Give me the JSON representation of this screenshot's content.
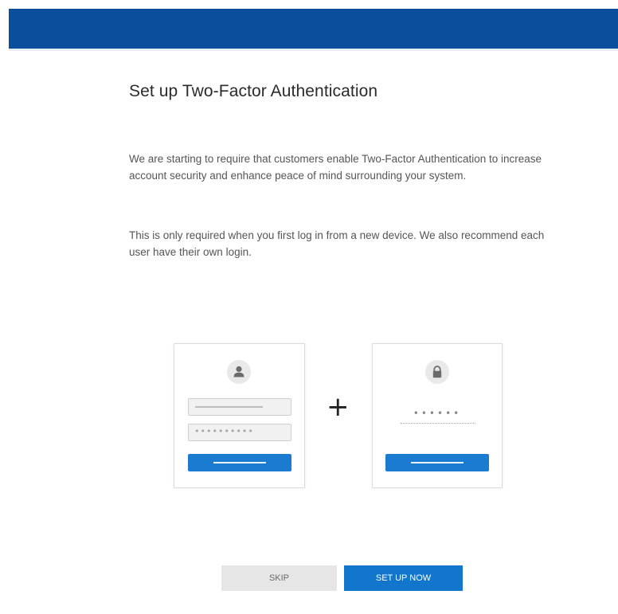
{
  "header": {
    "color": "#0b4f9c"
  },
  "main": {
    "title": "Set up Two-Factor Authentication",
    "paragraphs": [
      "We are starting to require that customers enable Two-Factor Authentication to increase account security and enhance peace of mind surrounding your system.",
      "This is only required when you first log in from a new device. We also recommend each user have their own login."
    ]
  },
  "illustration": {
    "login_card": {
      "icon": "user-icon",
      "password_mask": "••••••••••"
    },
    "separator": "+",
    "code_card": {
      "icon": "lock-icon",
      "code_mask": "••••••"
    }
  },
  "actions": {
    "skip_label": "Skip",
    "setup_label": "Set up now",
    "primary_color": "#1276cc"
  }
}
